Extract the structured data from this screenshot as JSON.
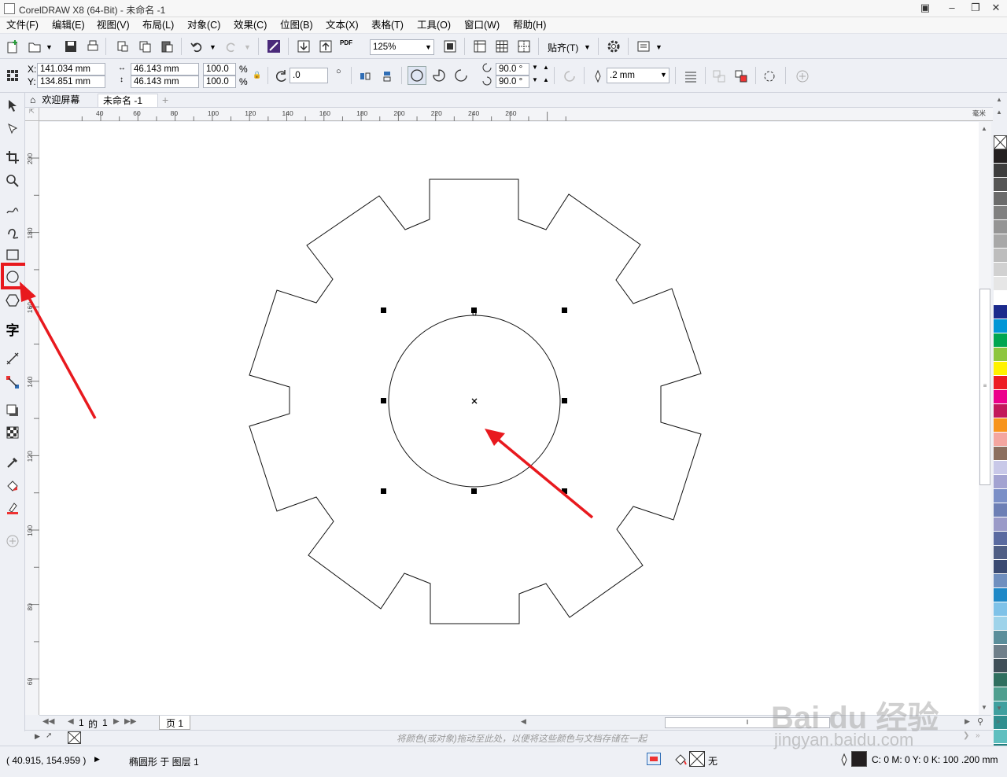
{
  "window": {
    "title": "CorelDRAW X8 (64-Bit) - 未命名 -1"
  },
  "menu": [
    "文件(F)",
    "编辑(E)",
    "视图(V)",
    "布局(L)",
    "对象(C)",
    "效果(C)",
    "位图(B)",
    "文本(X)",
    "表格(T)",
    "工具(O)",
    "窗口(W)",
    "帮助(H)"
  ],
  "toolbar": {
    "zoom": "125%",
    "snap_label": "贴齐(T)",
    "pdf_label": "PDF"
  },
  "properties": {
    "x": "141.034 mm",
    "y": "134.851 mm",
    "x_label": "X:",
    "y_label": "Y:",
    "width": "46.143 mm",
    "height": "46.143 mm",
    "scale_w": "100.0",
    "scale_h": "100.0",
    "pct": "%",
    "rotation": ".0",
    "start_angle": "90.0 °",
    "end_angle": "90.0 °",
    "outline_width": ".2 mm"
  },
  "tabs": {
    "welcome": "欢迎屏幕",
    "document": "未命名 -1",
    "add": "+"
  },
  "rulers": {
    "h_ticks": [
      "40",
      "60",
      "80",
      "100",
      "120",
      "140",
      "160",
      "180",
      "200",
      "220",
      "240",
      "260"
    ],
    "v_ticks": [
      "200",
      "180",
      "160",
      "140",
      "120",
      "100",
      "80",
      "60"
    ],
    "unit": "毫米"
  },
  "pagebar": {
    "current": "1",
    "of_label": "的",
    "total": "1",
    "page_tab": "页 1"
  },
  "docpalette": {
    "hint": "将颜色(或对象)拖动至此处，以便将这些颜色与文档存储在一起"
  },
  "status": {
    "coords": "( 40.915, 154.959 )",
    "object_info": "椭圆形 于 图层 1",
    "fill_none": "无",
    "outline_info": "C: 0 M: 0 Y: 0 K: 100  .200 mm"
  },
  "watermark": {
    "line1": "Bai du 经验",
    "line2": "jingyan.baidu.com"
  },
  "colors": {
    "accent_red": "#e8191e",
    "palette": [
      "#231f20",
      "#3d3d3d",
      "#555555",
      "#6b6b6b",
      "#808080",
      "#959595",
      "#a8a8a8",
      "#bdbdbd",
      "#d1d1d1",
      "#e6e6e6",
      "#ffffff",
      "#1b2a8c",
      "#0096d6",
      "#00a651",
      "#8dc63f",
      "#fff200",
      "#ed1c24",
      "#ec008c",
      "#c2185b",
      "#f7941d",
      "#f4a6a0",
      "#8c6f5f",
      "#c8c8e8",
      "#a3a3d1",
      "#7b8fc7",
      "#6d7fb5",
      "#9a9ac8",
      "#5a6aa0",
      "#4f5e85",
      "#3a4a72",
      "#6f8fbf",
      "#1e88c7",
      "#7fc2e8",
      "#9ed3ea",
      "#5b8e9b",
      "#6f7f8a",
      "#3f4f58",
      "#2f6f5f",
      "#4f9f8f",
      "#3fa09f",
      "#2f8f8f",
      "#5fbfbf",
      "#1f7f7f"
    ]
  }
}
